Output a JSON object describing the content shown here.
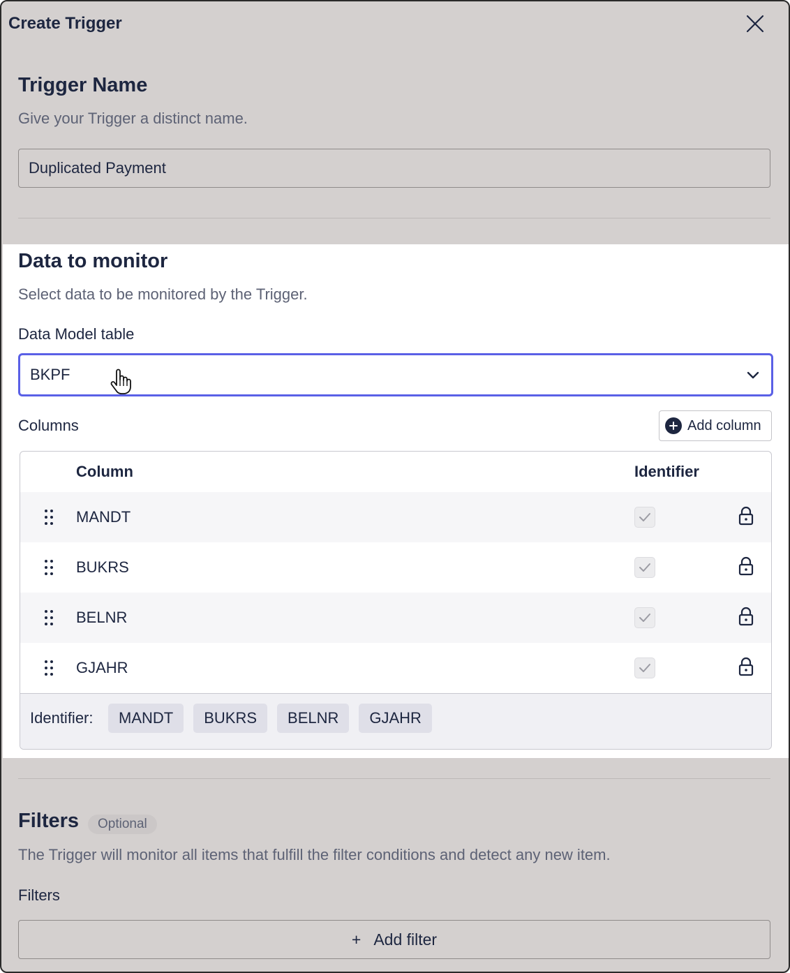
{
  "dialog": {
    "title": "Create Trigger"
  },
  "trigger_name": {
    "heading": "Trigger Name",
    "description": "Give your Trigger a distinct name.",
    "value": "Duplicated Payment"
  },
  "data_to_monitor": {
    "heading": "Data to monitor",
    "description": "Select data to be monitored by the Trigger.",
    "table_label": "Data Model table",
    "table_value": "BKPF",
    "columns_label": "Columns",
    "add_column_label": "Add column",
    "table": {
      "headers": [
        "Column",
        "Identifier"
      ],
      "rows": [
        {
          "name": "MANDT",
          "identifier": true
        },
        {
          "name": "BUKRS",
          "identifier": true
        },
        {
          "name": "BELNR",
          "identifier": true
        },
        {
          "name": "GJAHR",
          "identifier": true
        }
      ]
    },
    "identifier_label": "Identifier:",
    "identifier_chips": [
      "MANDT",
      "BUKRS",
      "BELNR",
      "GJAHR"
    ]
  },
  "filters": {
    "heading": "Filters",
    "badge": "Optional",
    "description": "The Trigger will monitor all items that fulfill the filter conditions and detect any new item.",
    "label": "Filters",
    "add_filter_label": "Add filter",
    "add_filter_glyph": "+"
  },
  "colors": {
    "backdrop": "#d4d0cf",
    "panel": "#ffffff",
    "focus_border": "#5a60e6",
    "text_primary": "#1d2640",
    "text_secondary": "#5d6275"
  },
  "icons": {
    "close": "close-icon",
    "chevron": "chevron-down-icon",
    "add": "plus-circle-icon",
    "drag": "drag-handle-icon",
    "check": "checkmark-icon",
    "lock": "lock-icon",
    "cursor": "hand-pointer-cursor-icon"
  }
}
